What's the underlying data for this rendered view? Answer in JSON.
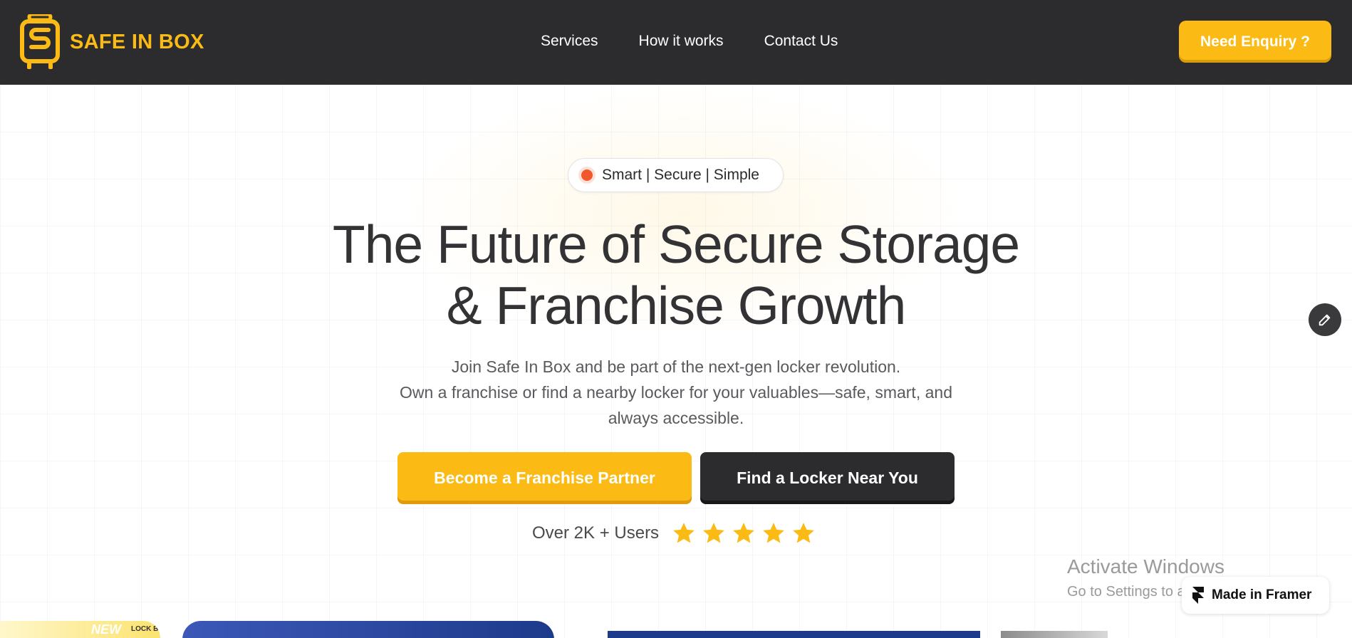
{
  "brand": {
    "name": "SAFE IN BOX",
    "accent": "#fbbb14",
    "dark": "#2c2c2f"
  },
  "nav": {
    "items": [
      "Services",
      "How it works",
      "Contact Us"
    ],
    "cta": "Need Enquiry ?"
  },
  "hero": {
    "badge": "Smart | Secure | Simple",
    "headline_line1": "The Future of Secure Storage",
    "headline_line2": "& Franchise Growth",
    "sub_line1": "Join Safe In Box and be part of the next-gen locker revolution.",
    "sub_line2": "Own a franchise or find a nearby locker for your valuables—safe, smart, and",
    "sub_line3": "always accessible.",
    "primary_cta": "Become a Franchise Partner",
    "secondary_cta": "Find a Locker Near You",
    "users_text": "Over 2K + Users",
    "rating": 5
  },
  "overlays": {
    "activate_title": "Activate Windows",
    "activate_sub": "Go to Settings to activate Windows.",
    "framer_badge": "Made in Framer"
  },
  "cards": {
    "card1_tag": "NEW",
    "card1_label": "LOCK B"
  },
  "icons": {
    "logo": "suitcase-s-icon",
    "badge": "status-dot-icon",
    "star": "star-icon",
    "edit": "pencil-icon",
    "framer": "framer-logo-icon"
  }
}
